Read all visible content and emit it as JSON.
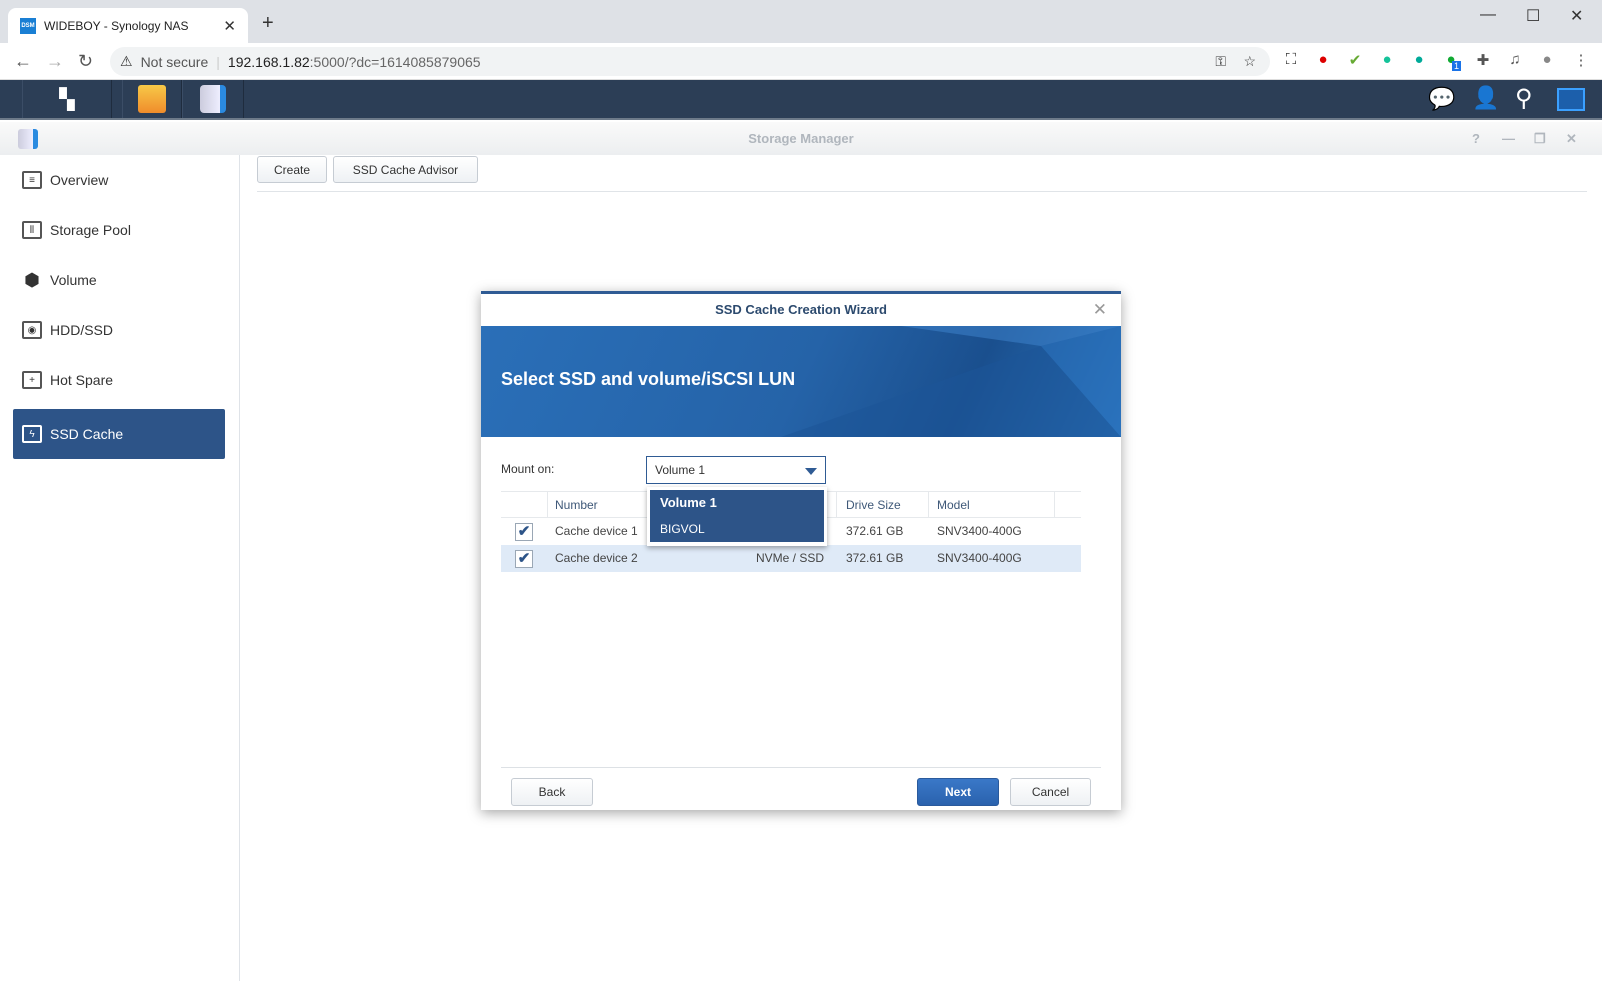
{
  "browser": {
    "tab_title": "WIDEBOY - Synology NAS",
    "favicon_text": "DSM",
    "security": "Not secure",
    "url_host": "192.168.1.82",
    "url_rest": ":5000/?dc=1614085879065",
    "extension_badge": "1"
  },
  "window": {
    "title": "Storage Manager"
  },
  "toolbar": {
    "create": "Create",
    "advisor": "SSD Cache Advisor"
  },
  "sidebar": {
    "items": [
      {
        "label": "Overview",
        "icon": "overview-icon"
      },
      {
        "label": "Storage Pool",
        "icon": "storage-pool-icon"
      },
      {
        "label": "Volume",
        "icon": "volume-icon"
      },
      {
        "label": "HDD/SSD",
        "icon": "hdd-icon"
      },
      {
        "label": "Hot Spare",
        "icon": "hot-spare-icon"
      },
      {
        "label": "SSD Cache",
        "icon": "ssd-cache-icon",
        "selected": true
      }
    ]
  },
  "dialog": {
    "title": "SSD Cache Creation Wizard",
    "heading": "Select SSD and volume/iSCSI LUN",
    "mount_label": "Mount on:",
    "mount_value": "Volume 1",
    "options": [
      "Volume 1",
      "BIGVOL"
    ],
    "columns": {
      "number": "Number",
      "size": "Drive Size",
      "model": "Model"
    },
    "rows": [
      {
        "checked": true,
        "number": "Cache device 1",
        "type": "NVMe / SSD",
        "size": "372.61 GB",
        "model": "SNV3400-400G"
      },
      {
        "checked": true,
        "number": "Cache device 2",
        "type": "NVMe / SSD",
        "size": "372.61 GB",
        "model": "SNV3400-400G"
      }
    ],
    "back": "Back",
    "next": "Next",
    "cancel": "Cancel"
  },
  "colors": {
    "accent": "#2d5488",
    "taskbar": "#2c3e56",
    "primary_button": "#2a62ad"
  }
}
